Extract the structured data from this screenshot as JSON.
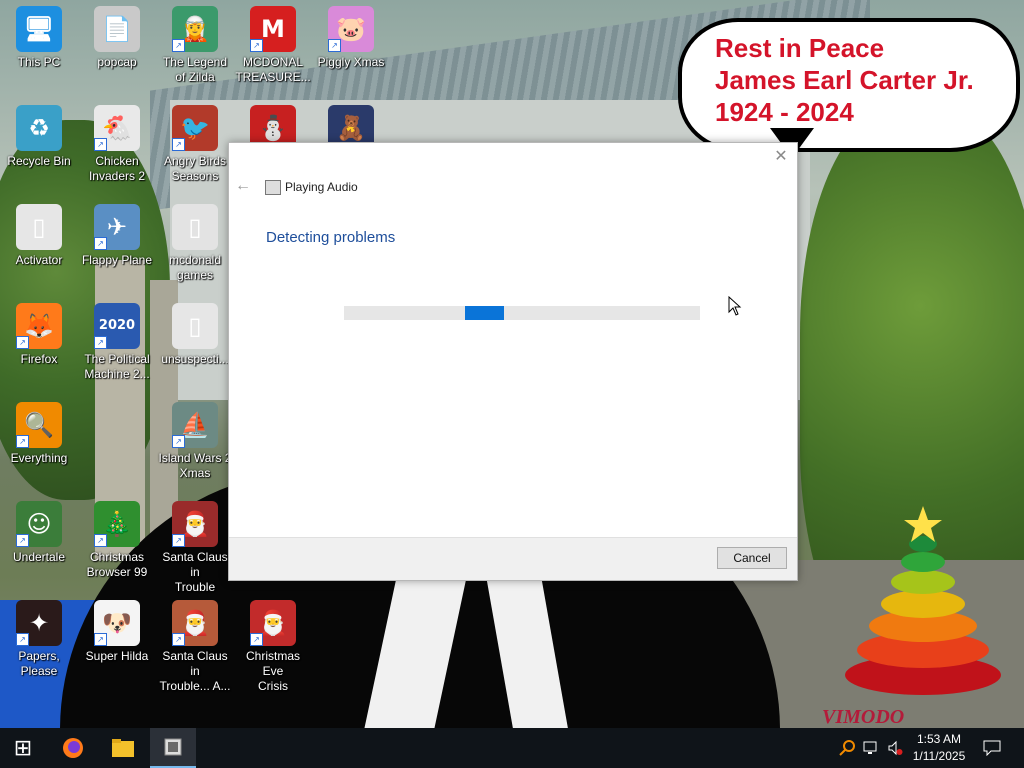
{
  "wallpaper": {
    "bubble_lines": [
      "Rest in Peace",
      "James Earl Carter Jr.",
      "1924 - 2024"
    ],
    "watermark": "VIMODO"
  },
  "desktop_icons": [
    {
      "name": "this-pc",
      "label": "This PC",
      "color": "#1d8fe0",
      "glyph": "🖥",
      "shortcut": false
    },
    {
      "name": "popcap",
      "label": "popcap",
      "color": "#c9c9c9",
      "glyph": "📄",
      "shortcut": false
    },
    {
      "name": "legend-of-zilda",
      "label": "The Legend\nof Zilda",
      "color": "#3b9a6b",
      "glyph": "🧝",
      "shortcut": true
    },
    {
      "name": "mcdonald-treasure",
      "label": "MCDONAL\nTREASURE...",
      "color": "#d61f1f",
      "glyph": "M",
      "shortcut": true
    },
    {
      "name": "piggly-xmas",
      "label": "Piggly Xmas",
      "color": "#d98ad9",
      "glyph": "🐷",
      "shortcut": true
    },
    {
      "name": "recycle-bin",
      "label": "Recycle Bin",
      "color": "#3aa0c8",
      "glyph": "♻",
      "shortcut": false
    },
    {
      "name": "chicken-invaders-2",
      "label": "Chicken\nInvaders 2",
      "color": "#e9e9e9",
      "glyph": "🐔",
      "shortcut": true
    },
    {
      "name": "angry-birds-seasons",
      "label": "Angry Birds\nSeasons",
      "color": "#b23a2a",
      "glyph": "🐦",
      "shortcut": true
    },
    {
      "name": "partial-icon-1",
      "label": "",
      "color": "#c72020",
      "glyph": "⛄",
      "shortcut": false
    },
    {
      "name": "partial-icon-2",
      "label": "",
      "color": "#2a3a6a",
      "glyph": "🧸",
      "shortcut": false
    },
    {
      "name": "activator",
      "label": "Activator",
      "color": "#e6e6e6",
      "glyph": "▯",
      "shortcut": false
    },
    {
      "name": "flappy-plane",
      "label": "Flappy Plane",
      "color": "#5a8fc4",
      "glyph": "✈",
      "shortcut": true
    },
    {
      "name": "mcdonald-games",
      "label": "mcdonald\ngames",
      "color": "#e3e3e3",
      "glyph": "▯",
      "shortcut": false
    },
    {
      "name": "firefox",
      "label": "Firefox",
      "color": "#ff7a1a",
      "glyph": "🦊",
      "shortcut": true
    },
    {
      "name": "political-machine",
      "label": "The Political\nMachine 2...",
      "color": "#2a5ab0",
      "glyph": "2020",
      "shortcut": true
    },
    {
      "name": "unsuspecting",
      "label": "unsuspecti...",
      "color": "#e6e6e6",
      "glyph": "▯",
      "shortcut": false
    },
    {
      "name": "everything",
      "label": "Everything",
      "color": "#f08a00",
      "glyph": "🔍",
      "shortcut": true
    },
    {
      "name": "island-wars-2-xmas",
      "label": "Island Wars 2\nXmas",
      "color": "#6c8a84",
      "glyph": "⛵",
      "shortcut": true
    },
    {
      "name": "undertale",
      "label": "Undertale",
      "color": "#3b7d3a",
      "glyph": "☺",
      "shortcut": true
    },
    {
      "name": "christmas-browser-99",
      "label": "Christmas\nBrowser 99",
      "color": "#2f8f2f",
      "glyph": "🎄",
      "shortcut": true
    },
    {
      "name": "santa-claus-in-trouble",
      "label": "Santa Claus in\nTrouble",
      "color": "#9a2b2b",
      "glyph": "🎅",
      "shortcut": true
    },
    {
      "name": "papers-please",
      "label": "Papers, Please",
      "color": "#2a1a1a",
      "glyph": "✦",
      "shortcut": true
    },
    {
      "name": "super-hilda",
      "label": "Super Hilda",
      "color": "#f4f4f4",
      "glyph": "🐶",
      "shortcut": true
    },
    {
      "name": "santa-claus-in-trouble-a",
      "label": "Santa Claus in\nTrouble... A...",
      "color": "#b65a3a",
      "glyph": "🎅",
      "shortcut": true
    },
    {
      "name": "christmas-eve-crisis",
      "label": "Christmas Eve\nCrisis",
      "color": "#c22b2b",
      "glyph": "🎅",
      "shortcut": true
    }
  ],
  "dialog": {
    "title": "Playing Audio",
    "heading": "Detecting problems",
    "progress_fraction": 0.34,
    "cancel_label": "Cancel",
    "close_glyph": "✕",
    "back_glyph": "←"
  },
  "taskbar": {
    "start_glyph": "⊞",
    "apps": [
      "firefox-icon",
      "file-explorer-icon",
      "troubleshooter-icon"
    ],
    "time": "1:53 AM",
    "date": "1/11/2025"
  },
  "colors": {
    "accent": "#0a74d8",
    "heading": "#1e4e9b",
    "taskbar": "#0f1419"
  }
}
